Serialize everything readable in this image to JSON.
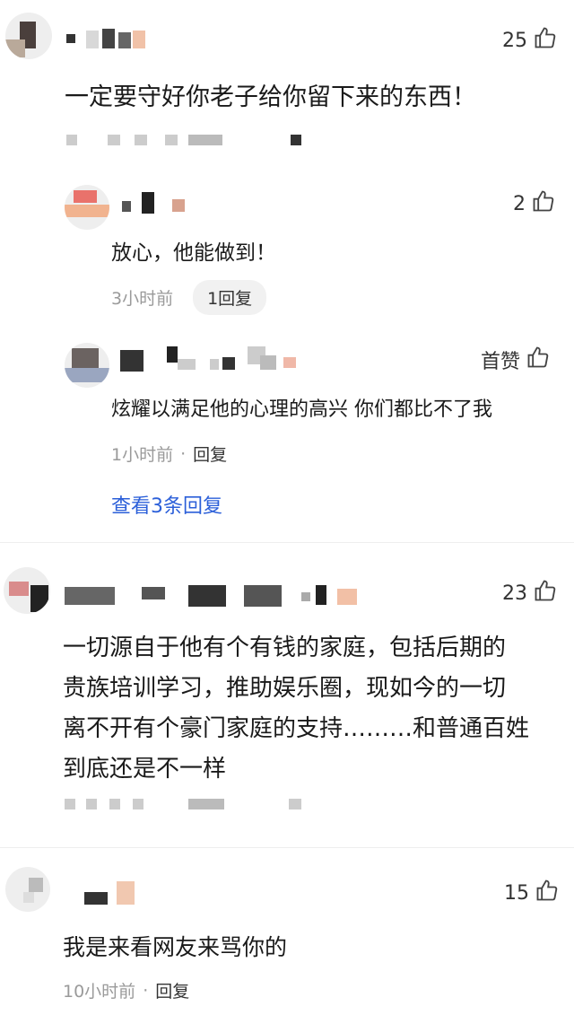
{
  "comments": [
    {
      "likes": "25",
      "text": "一定要守好你老子给你留下来的东西！",
      "replies": [
        {
          "likes": "2",
          "text": "放心，他能做到！",
          "time": "3小时前",
          "reply_count_label": "1回复"
        },
        {
          "likes_label": "首赞",
          "text": "炫耀以满足他的心理的高兴 你们都比不了我",
          "time": "1小时前",
          "dot": "·",
          "reply_label": "回复"
        }
      ],
      "view_more_label": "查看3条回复"
    },
    {
      "likes": "23",
      "text_lines": [
        "一切源自于他有个有钱的家庭，包括后期的",
        "贵族培训学习，推助娱乐圈，现如今的一切",
        "离不开有个豪门家庭的支持………和普通百姓",
        "到底还是不一样"
      ]
    },
    {
      "likes": "15",
      "text": "我是来看网友来骂你的",
      "time": "10小时前",
      "dot": "·",
      "reply_label": "回复"
    }
  ],
  "icons": {
    "like": "thumbs-up-icon"
  },
  "colors": {
    "link": "#2b5fd9",
    "meta": "#9a9a9a",
    "divider": "#eeeeee"
  }
}
